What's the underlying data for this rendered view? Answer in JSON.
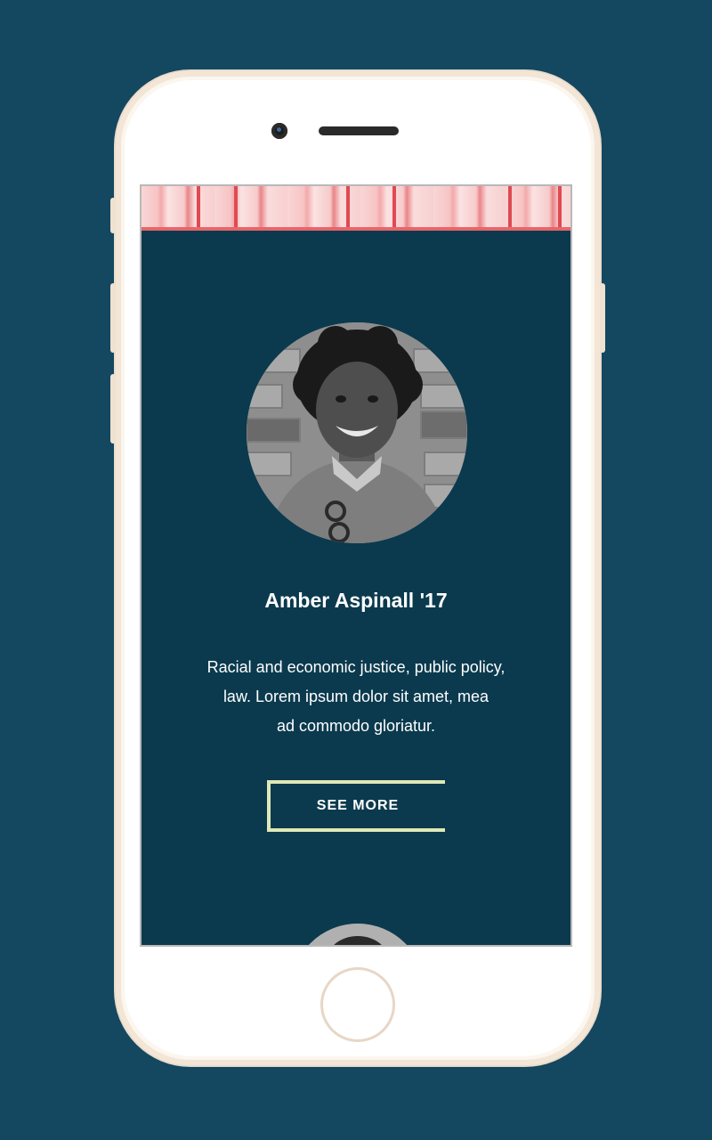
{
  "profile": {
    "name": "Amber Aspinall '17",
    "bio_lines": [
      "Racial and economic justice, public policy,",
      "law. Lorem ipsum dolor sit amet, mea",
      "ad commodo gloriatur."
    ],
    "see_more_label": "SEE MORE"
  },
  "colors": {
    "background": "#144760",
    "screen": "#0b3a4e",
    "banner_accent": "#e7656a",
    "button_border": "#dfe8b8",
    "phone_frame": "#fbf6ee"
  }
}
